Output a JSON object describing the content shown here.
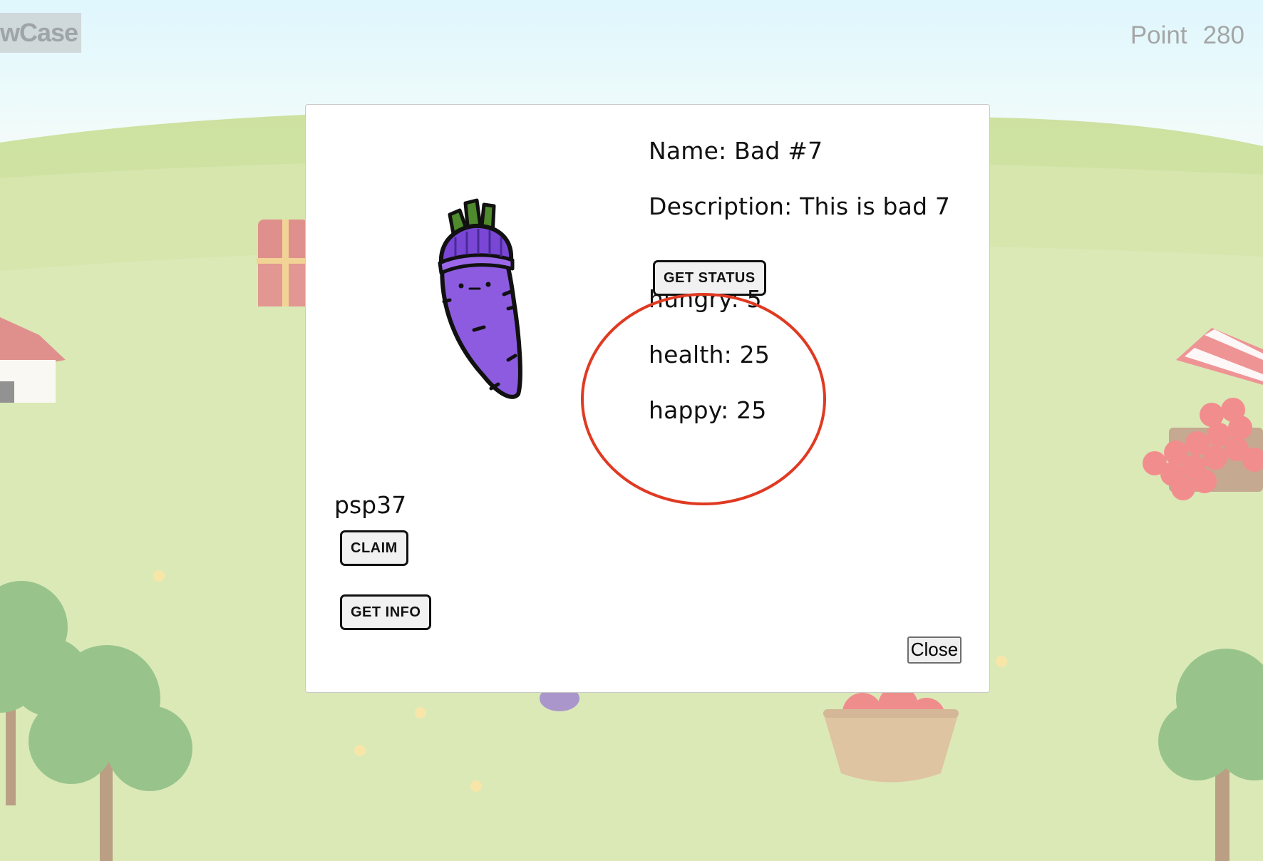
{
  "header": {
    "brand_text": "wCase",
    "points_label": "Point",
    "points_value": "280"
  },
  "modal": {
    "name_line": "Name: Bad #7",
    "description_line": "Description: This is bad 7",
    "get_status_label": "GET STATUS",
    "status": {
      "hungry": "hungry: 5",
      "health": "health: 25",
      "happy": "happy: 25"
    },
    "owner": "psp37",
    "claim_label": "CLAIM",
    "get_info_label": "GET INFO",
    "close_label": "Close"
  },
  "icons": {
    "vegetable": "purple-radish-with-beanie-icon"
  },
  "colors": {
    "sky_top": "#d6f3fb",
    "grass": "#c5dc8a",
    "annotation_red": "#e03a22",
    "radish_purple": "#8d5be0",
    "beanie_purple": "#7a46d6",
    "leaf_green": "#4f8a2c"
  }
}
